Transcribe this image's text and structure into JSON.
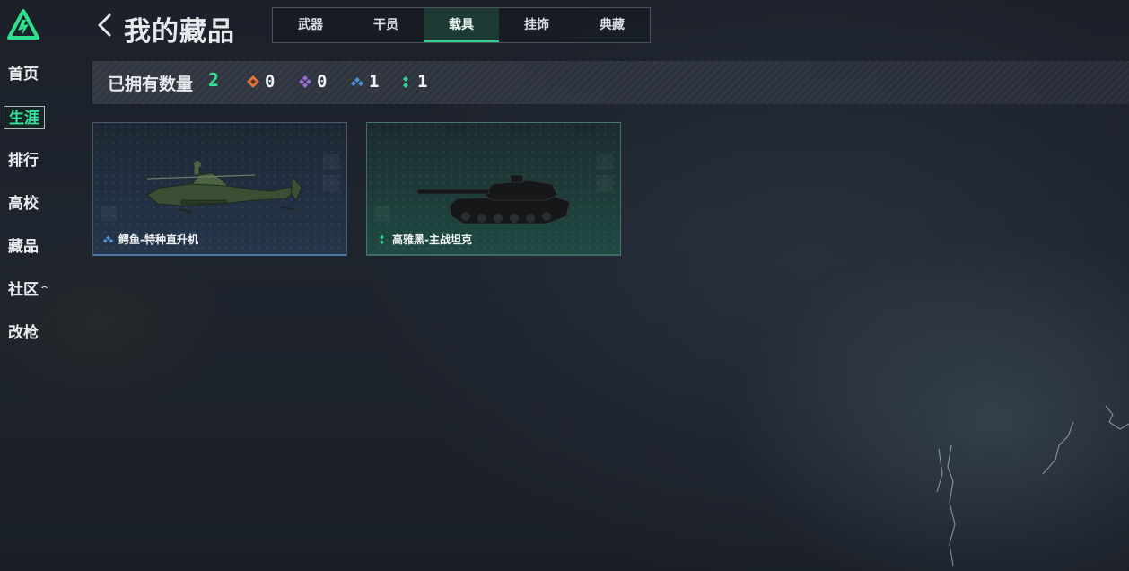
{
  "header": {
    "title": "我的藏品",
    "tabs": [
      {
        "label": "武器",
        "active": false
      },
      {
        "label": "干员",
        "active": false
      },
      {
        "label": "载具",
        "active": true
      },
      {
        "label": "挂饰",
        "active": false
      },
      {
        "label": "典藏",
        "active": false
      }
    ]
  },
  "sidebar": {
    "items": [
      {
        "label": "首页"
      },
      {
        "label": "生涯",
        "active": true
      },
      {
        "label": "排行"
      },
      {
        "label": "高校"
      },
      {
        "label": "藏品"
      },
      {
        "label": "社区",
        "caret": "^"
      },
      {
        "label": "改枪"
      }
    ]
  },
  "summary": {
    "label": "已拥有数量",
    "count": "2",
    "stats": [
      {
        "icon": "orange-gem-icon",
        "color": "#d9773e",
        "value": "0"
      },
      {
        "icon": "purple-gem-icon",
        "color": "#9a6ad8",
        "value": "0"
      },
      {
        "icon": "blue-gem-icon",
        "color": "#4f8fd6",
        "value": "1"
      },
      {
        "icon": "green-gem-icon",
        "color": "#2fd18d",
        "value": "1"
      }
    ]
  },
  "cards": [
    {
      "name": "鳄鱼-特种直升机",
      "rarity_color": "#4f8fd6",
      "icon": "helicopter-icon"
    },
    {
      "name": "高雅黑-主战坦克",
      "rarity_color": "#2fd18d",
      "icon": "tank-icon"
    }
  ],
  "colors": {
    "accent": "#2fe08d",
    "background": "#1e242d"
  }
}
